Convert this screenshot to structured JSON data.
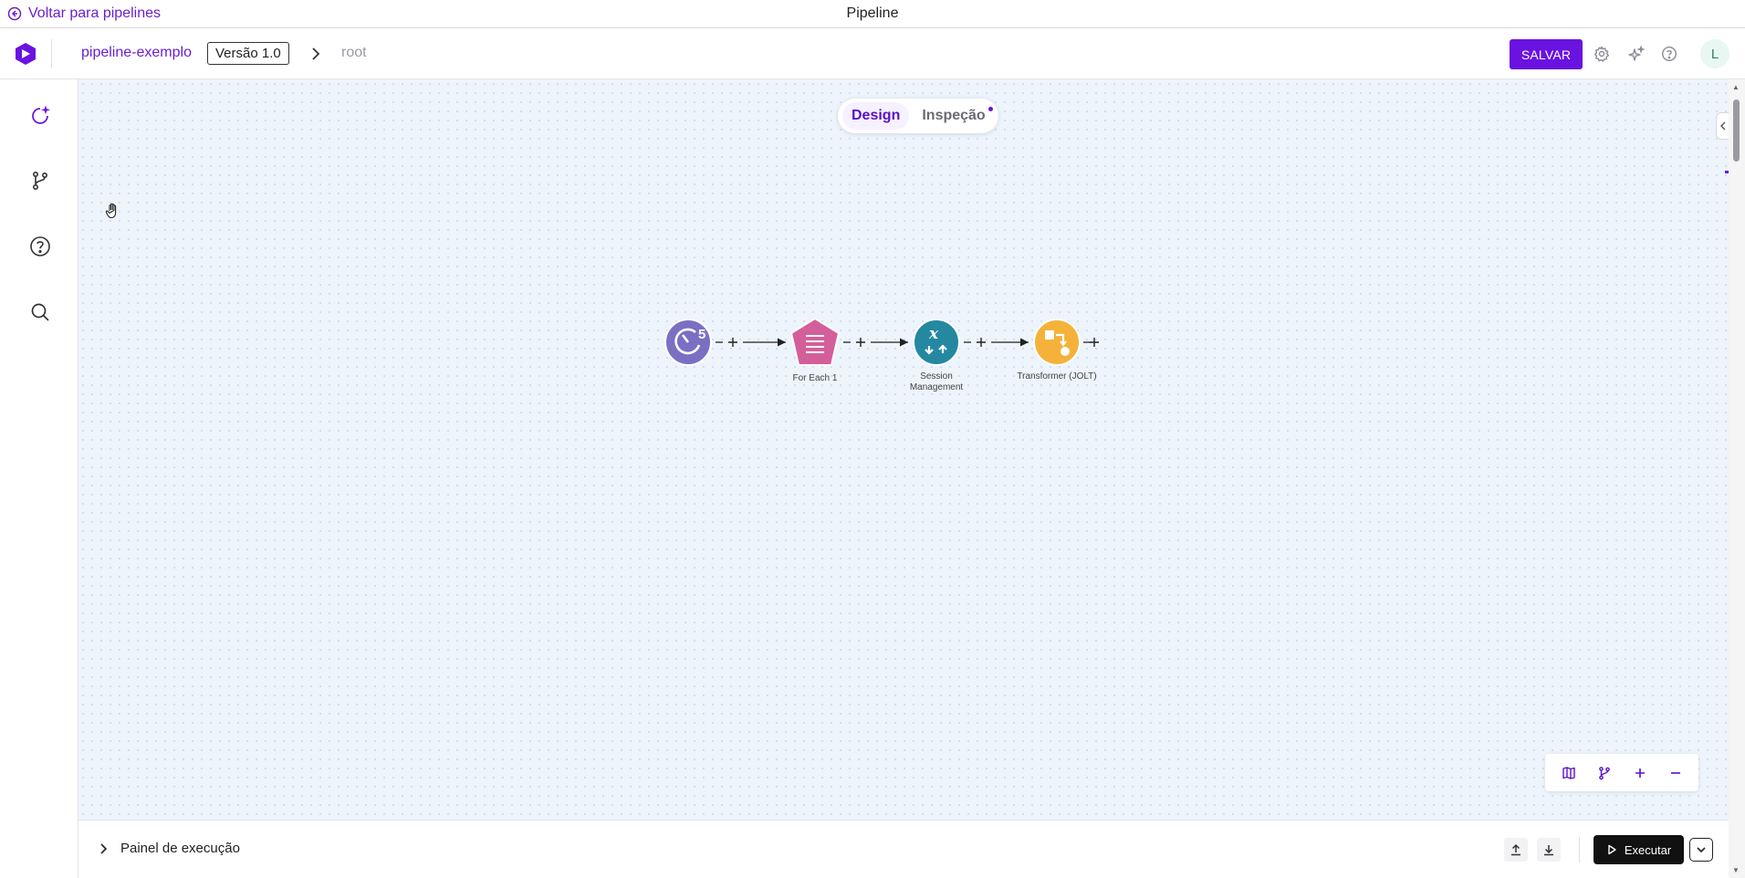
{
  "titlebar": {
    "back_label": "Voltar para pipelines",
    "title": "Pipeline"
  },
  "header": {
    "pipeline_name": "pipeline-exemplo",
    "version": "Versão 1.0",
    "breadcrumb_root": "root",
    "save_label": "SALVAR",
    "avatar_initial": "L",
    "icons": [
      "settings-icon",
      "sparkle-icon",
      "help-icon"
    ]
  },
  "sidebar": {
    "items": [
      "new-pipeline-icon",
      "branch-icon",
      "help-icon",
      "search-icon"
    ]
  },
  "canvas": {
    "tabs": [
      {
        "label": "Design",
        "active": true
      },
      {
        "label": "Inspeção",
        "active": false,
        "has_dot": true
      }
    ],
    "nodes": [
      {
        "label": "",
        "icon": "timer-5-icon",
        "color": "#7b6fc4"
      },
      {
        "label": "For Each 1",
        "icon": "for-each-icon",
        "color": "#d35f9a"
      },
      {
        "label": "Session Management",
        "icon": "session-variable-icon",
        "color": "#2488a0"
      },
      {
        "label": "Transformer (JOLT)",
        "icon": "transformer-icon",
        "color": "#f5b23a"
      }
    ],
    "zoom_controls": [
      "map-icon",
      "branch-icon",
      "zoom-in-icon",
      "zoom-out-icon"
    ]
  },
  "bottom_panel": {
    "execution_label": "Painel de execução",
    "run_label": "Executar"
  },
  "colors": {
    "brand": "#6a12e0",
    "canvas_bg": "#edf4fc"
  }
}
